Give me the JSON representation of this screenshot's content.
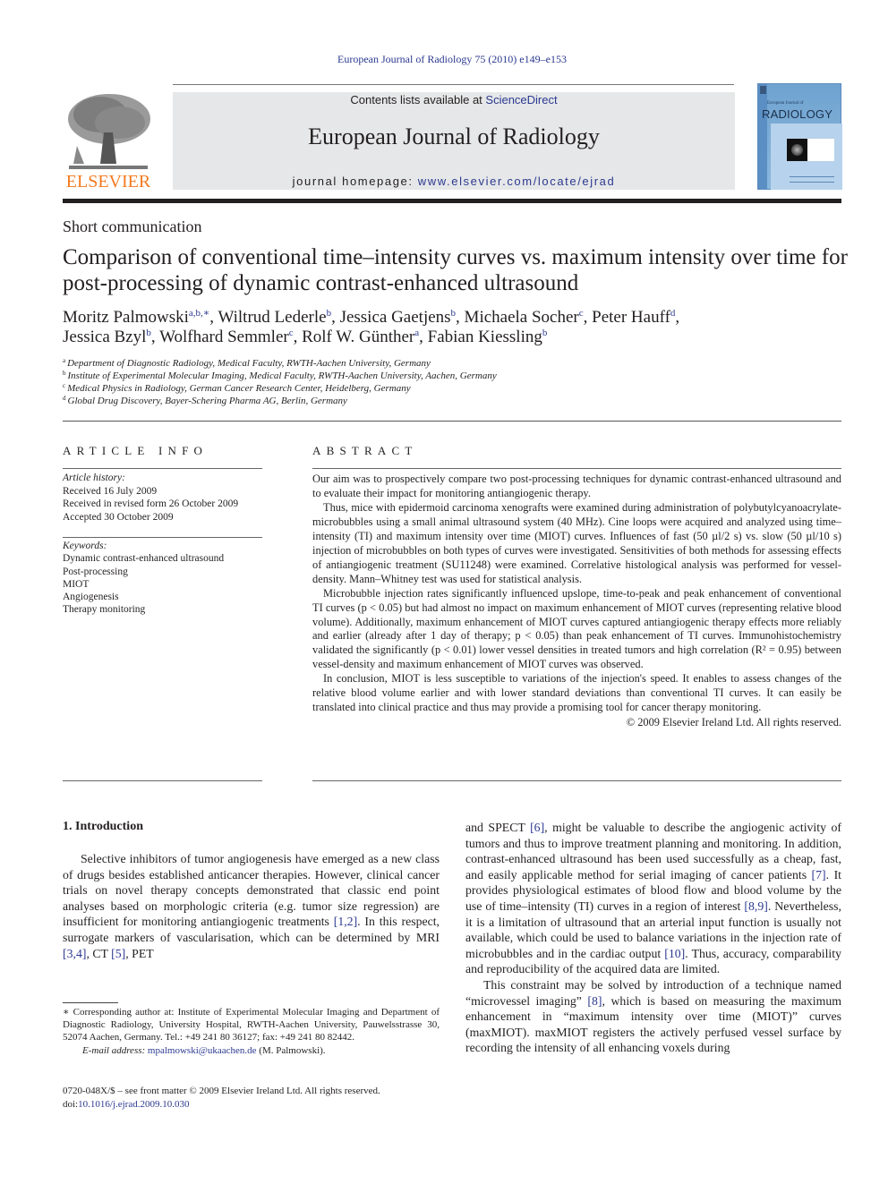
{
  "header": {
    "citation": "European Journal of Radiology 75 (2010) e149–e153",
    "contents_prefix": "Contents lists available at ",
    "contents_link": "ScienceDirect",
    "journal_title": "European Journal of Radiology",
    "homepage_prefix": "journal homepage: ",
    "homepage_link": "www.elsevier.com/locate/ejrad",
    "publisher_logo_text": "ELSEVIER",
    "cover": {
      "small_title": "European Journal of",
      "big_title": "RADIOLOGY"
    },
    "colors": {
      "link": "#2b3990",
      "elsevier_orange": "#f47a20",
      "masthead_bg": "#e6e7e8"
    }
  },
  "article": {
    "type": "Short communication",
    "title": "Comparison of conventional time–intensity curves vs. maximum intensity over time for post-processing of dynamic contrast-enhanced ultrasound",
    "authors": [
      {
        "name": "Moritz Palmowski",
        "aff": "a,b,∗",
        "sep": ", "
      },
      {
        "name": "Wiltrud Lederle",
        "aff": "b",
        "sep": ", "
      },
      {
        "name": "Jessica Gaetjens",
        "aff": "b",
        "sep": ", "
      },
      {
        "name": "Michaela Socher",
        "aff": "c",
        "sep": ", "
      },
      {
        "name": "Peter Hauff",
        "aff": "d",
        "sep": ","
      },
      {
        "name": "Jessica Bzyl",
        "aff": "b",
        "sep": ", "
      },
      {
        "name": "Wolfhard Semmler",
        "aff": "c",
        "sep": ", "
      },
      {
        "name": "Rolf W. Günther",
        "aff": "a",
        "sep": ", "
      },
      {
        "name": "Fabian Kiessling",
        "aff": "b",
        "sep": ""
      }
    ],
    "affiliations": [
      {
        "key": "a",
        "text": "Department of Diagnostic Radiology, Medical Faculty, RWTH-Aachen University, Germany"
      },
      {
        "key": "b",
        "text": "Institute of Experimental Molecular Imaging, Medical Faculty, RWTH-Aachen University, Aachen, Germany"
      },
      {
        "key": "c",
        "text": "Medical Physics in Radiology, German Cancer Research Center, Heidelberg, Germany"
      },
      {
        "key": "d",
        "text": "Global Drug Discovery, Bayer-Schering Pharma AG, Berlin, Germany"
      }
    ]
  },
  "article_info": {
    "heading": "ARTICLE INFO",
    "history_label": "Article history:",
    "history": [
      "Received 16 July 2009",
      "Received in revised form 26 October 2009",
      "Accepted 30 October 2009"
    ],
    "keywords_label": "Keywords:",
    "keywords": [
      "Dynamic contrast-enhanced ultrasound",
      "Post-processing",
      "MIOT",
      "Angiogenesis",
      "Therapy monitoring"
    ]
  },
  "abstract": {
    "heading": "ABSTRACT",
    "paragraphs": [
      "Our aim was to prospectively compare two post-processing techniques for dynamic contrast-enhanced ultrasound and to evaluate their impact for monitoring antiangiogenic therapy.",
      "Thus, mice with epidermoid carcinoma xenografts were examined during administration of polybutylcyanoacrylate-microbubbles using a small animal ultrasound system (40 MHz). Cine loops were acquired and analyzed using time–intensity (TI) and maximum intensity over time (MIOT) curves. Influences of fast (50 µl/2 s) vs. slow (50 µl/10 s) injection of microbubbles on both types of curves were investigated. Sensitivities of both methods for assessing effects of antiangiogenic treatment (SU11248) were examined. Correlative histological analysis was performed for vessel-density. Mann–Whitney test was used for statistical analysis.",
      "Microbubble injection rates significantly influenced upslope, time-to-peak and peak enhancement of conventional TI curves (p < 0.05) but had almost no impact on maximum enhancement of MIOT curves (representing relative blood volume). Additionally, maximum enhancement of MIOT curves captured antiangiogenic therapy effects more reliably and earlier (already after 1 day of therapy; p < 0.05) than peak enhancement of TI curves. Immunohistochemistry validated the significantly (p < 0.01) lower vessel densities in treated tumors and high correlation (R² = 0.95) between vessel-density and maximum enhancement of MIOT curves was observed.",
      "In conclusion, MIOT is less susceptible to variations of the injection's speed. It enables to assess changes of the relative blood volume earlier and with lower standard deviations than conventional TI curves. It can easily be translated into clinical practice and thus may provide a promising tool for cancer therapy monitoring."
    ],
    "copyright": "© 2009 Elsevier Ireland Ltd. All rights reserved."
  },
  "body": {
    "section_heading": "1.  Introduction",
    "left_paragraph": [
      {
        "t": "Selective inhibitors of tumor angiogenesis have emerged as a new class of drugs besides established anticancer therapies. However, clinical cancer trials on novel therapy concepts demonstrated that classic end point analyses based on morphologic criteria (e.g. tumor size regression) are insufficient for monitoring antiangiogenic treatments "
      },
      {
        "ref": "[1,2]"
      },
      {
        "t": ". In this respect, surrogate markers of vascularisation, which can be determined by MRI "
      },
      {
        "ref": "[3,4]"
      },
      {
        "t": ", CT "
      },
      {
        "ref": "[5]"
      },
      {
        "t": ", PET"
      }
    ],
    "right_paragraph_1": [
      {
        "t": "and SPECT "
      },
      {
        "ref": "[6]"
      },
      {
        "t": ", might be valuable to describe the angiogenic activity of tumors and thus to improve treatment planning and monitoring. In addition, contrast-enhanced ultrasound has been used successfully as a cheap, fast, and easily applicable method for serial imaging of cancer patients "
      },
      {
        "ref": "[7]"
      },
      {
        "t": ". It provides physiological estimates of blood flow and blood volume by the use of time–intensity (TI) curves in a region of interest "
      },
      {
        "ref": "[8,9]"
      },
      {
        "t": ". Nevertheless, it is a limitation of ultrasound that an arterial input function is usually not available, which could be used to balance variations in the injection rate of microbubbles and in the cardiac output "
      },
      {
        "ref": "[10]"
      },
      {
        "t": ". Thus, accuracy, comparability and reproducibility of the acquired data are limited."
      }
    ],
    "right_paragraph_2": [
      {
        "t": "This constraint may be solved by introduction of a technique named “microvessel imaging” "
      },
      {
        "ref": "[8]"
      },
      {
        "t": ", which is based on measuring the maximum enhancement in “maximum intensity over time (MIOT)” curves (maxMIOT). maxMIOT registers the actively perfused vessel surface by recording the intensity of all enhancing voxels during"
      }
    ]
  },
  "footnote": {
    "corresponding": "∗  Corresponding author at: Institute of Experimental Molecular Imaging and Department of Diagnostic Radiology, University Hospital, RWTH-Aachen University, Pauwelsstrasse 30, 52074 Aachen, Germany. Tel.: +49 241 80 36127; fax: +49 241 80 82442.",
    "email_label": "E-mail address: ",
    "email": "mpalmowski@ukaachen.de",
    "email_suffix": " (M. Palmowski).",
    "front_matter": "0720-048X/$ – see front matter © 2009 Elsevier Ireland Ltd. All rights reserved.",
    "doi_label": "doi:",
    "doi": "10.1016/j.ejrad.2009.10.030"
  }
}
